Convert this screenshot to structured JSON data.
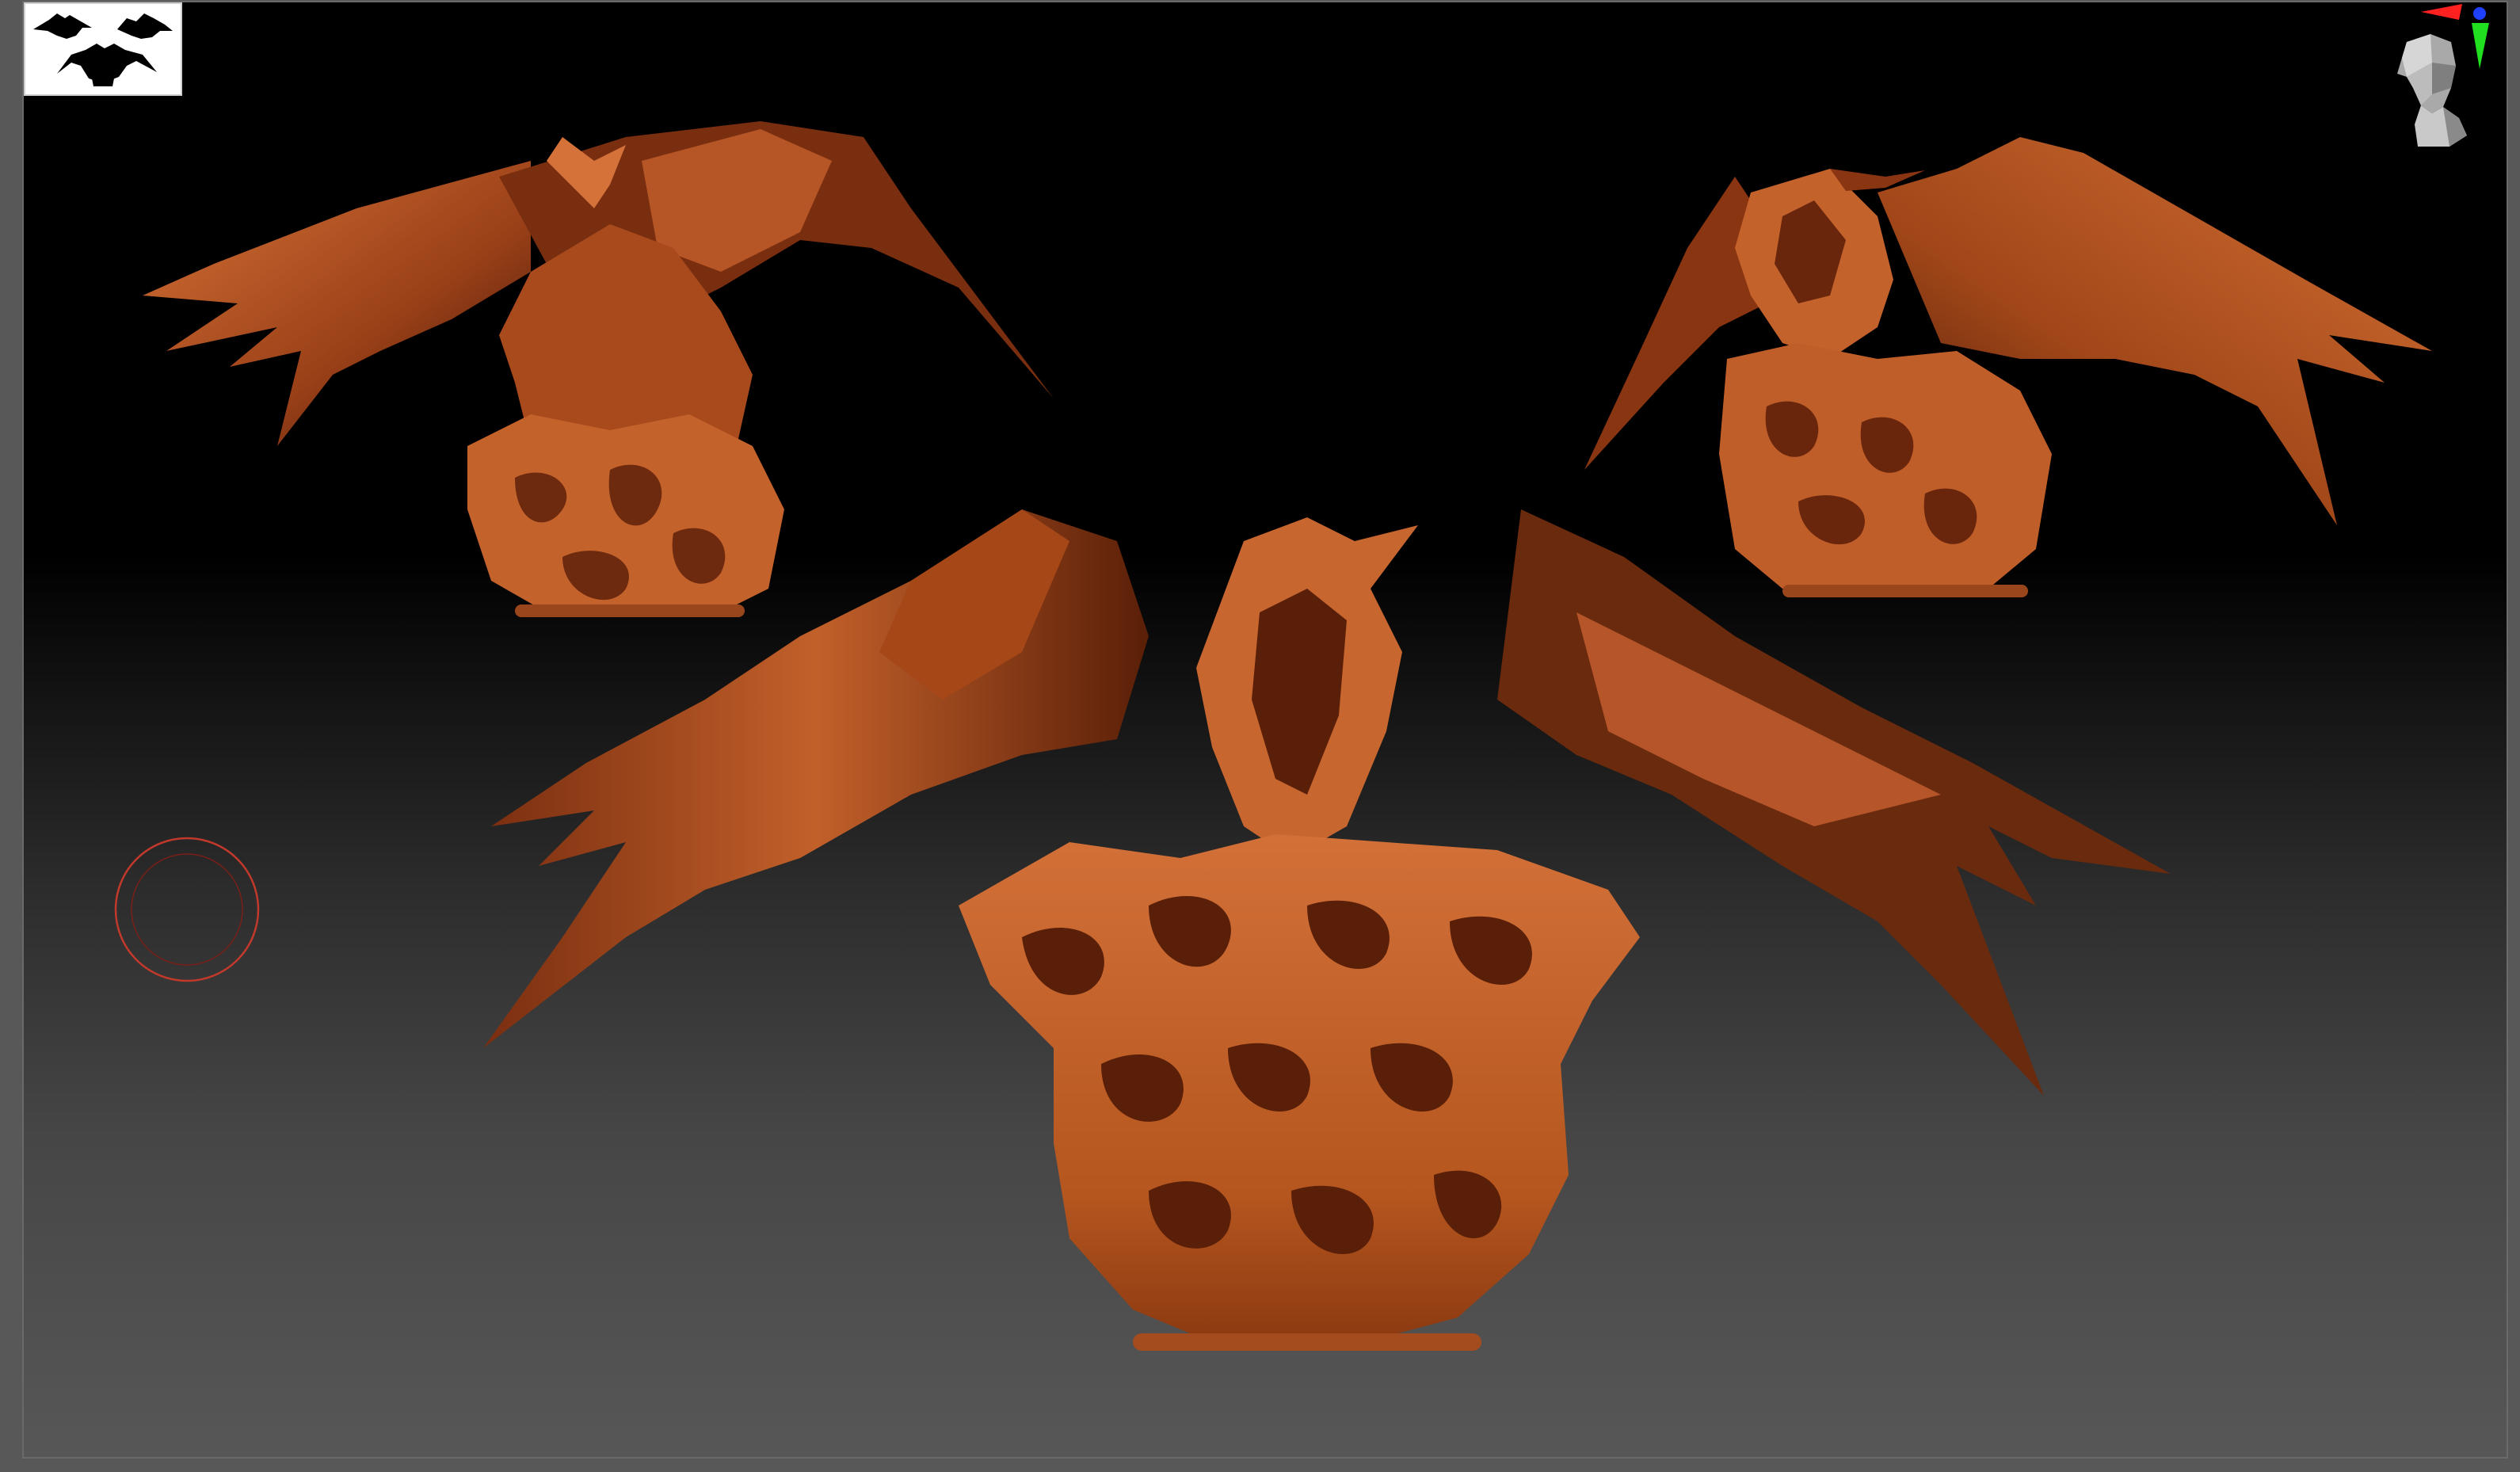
{
  "app": {
    "name": "",
    "scene": "",
    "colors": {
      "viewport_top": "#000000",
      "viewport_bottom": "#575757",
      "window_frame": "#585858",
      "model_base": "#c8662e",
      "model_shadow": "#4a1a08",
      "model_mid": "#8a3a14",
      "brush_ring": "#c0392b",
      "axis_x": "#ff2020",
      "axis_y": "#20e020",
      "axis_z": "#2040ff"
    }
  },
  "viewport": {
    "navigation_icon": "head-navigation-icon",
    "axis_icon": "xyz-axis-gizmo-icon",
    "brush_icon": "brush-cursor-icon",
    "thumbnail_icon": "document-silhouette-thumbnail-icon"
  },
  "models": [
    {
      "id": "main",
      "icon": "winged-creature-sculpt-front-view"
    },
    {
      "id": "left",
      "icon": "winged-creature-sculpt-left-view"
    },
    {
      "id": "right",
      "icon": "winged-creature-sculpt-right-view"
    }
  ]
}
